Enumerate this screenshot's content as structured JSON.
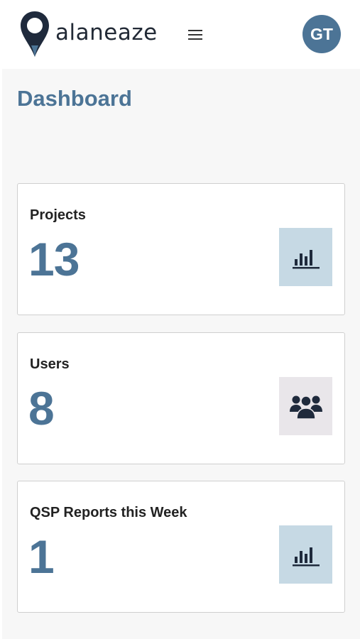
{
  "header": {
    "brand_name": "alaneaze",
    "logo_icon": "map-pin-logo-icon",
    "menu_icon": "hamburger-menu-icon",
    "avatar_initials": "GT",
    "avatar_color": "#4c7496"
  },
  "page": {
    "title": "Dashboard"
  },
  "cards": [
    {
      "label": "Projects",
      "value": "13",
      "icon": "bar-chart-icon",
      "icon_bg": "#c6d9e4"
    },
    {
      "label": "Users",
      "value": "8",
      "icon": "users-group-icon",
      "icon_bg": "#e9e6ea"
    },
    {
      "label": "QSP Reports this Week",
      "value": "1",
      "icon": "bar-chart-icon",
      "icon_bg": "#c6d9e4"
    }
  ],
  "colors": {
    "accent": "#4c7496",
    "icon_dark": "#1f2a3c",
    "background": "#f7f7f7"
  }
}
